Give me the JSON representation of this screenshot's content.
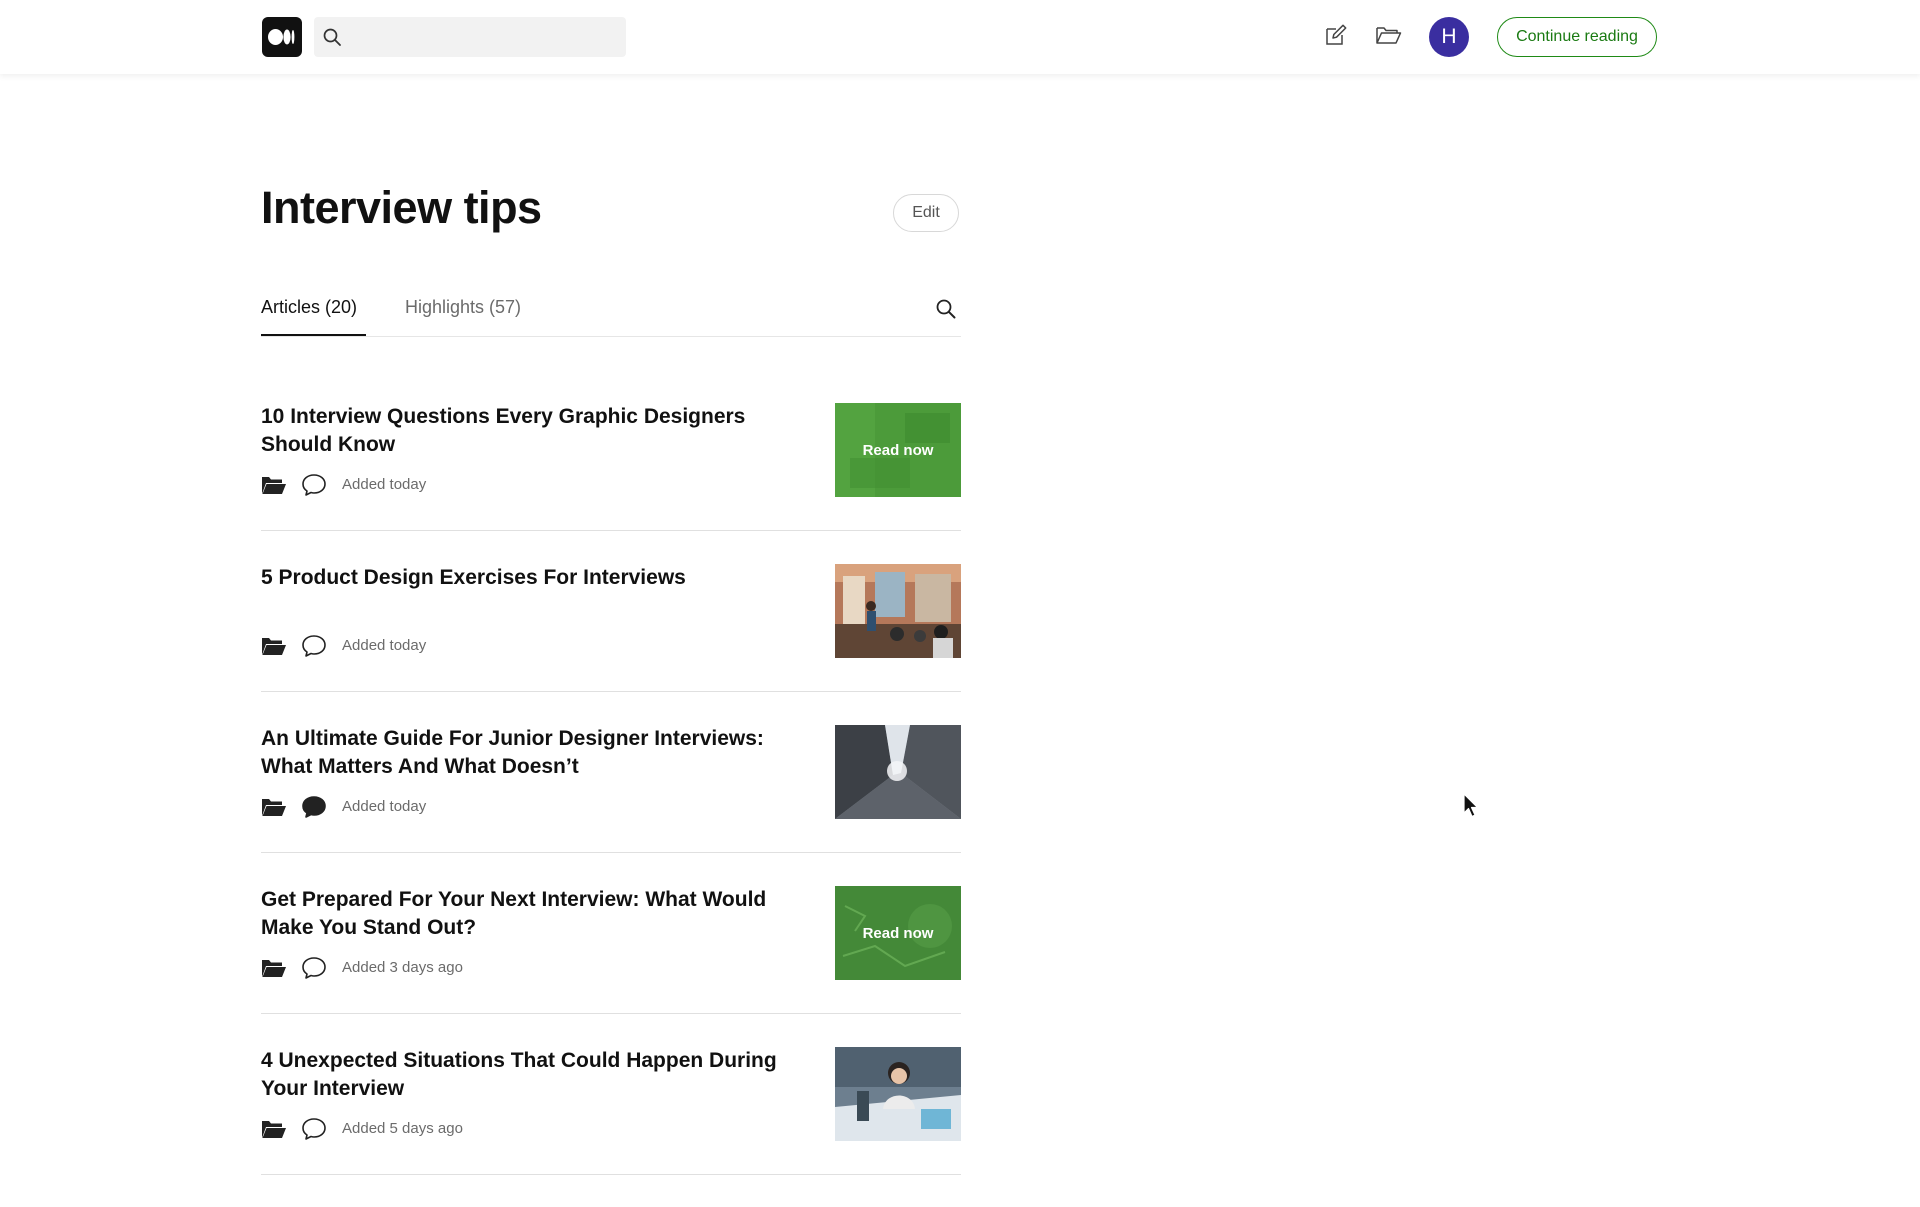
{
  "header": {
    "logo_name": "medium-logo",
    "search_placeholder": "",
    "avatar_initial": "H",
    "continue_label": "Continue reading"
  },
  "page": {
    "title": "Interview tips",
    "edit_label": "Edit"
  },
  "tabs": [
    {
      "label": "Articles (20)",
      "active": true
    },
    {
      "label": "Highlights (57)",
      "active": false
    }
  ],
  "articles": [
    {
      "title": "10 Interview Questions Every Graphic Designers Should Know",
      "added": "Added today",
      "overlay": "Read now",
      "comment_filled": false,
      "thumb": "green-read-now"
    },
    {
      "title": "5 Product Design Exercises For Interviews",
      "added": "Added today",
      "overlay": "",
      "comment_filled": false,
      "thumb": "office-meeting-photo"
    },
    {
      "title": "An Ultimate Guide For Junior Designer Interviews: What Matters And What Doesn’t",
      "added": "Added today",
      "overlay": "",
      "comment_filled": true,
      "thumb": "skyscrapers-photo"
    },
    {
      "title": "Get Prepared For Your Next Interview: What Would Make You Stand Out?",
      "added": "Added 3 days ago",
      "overlay": "Read now",
      "comment_filled": false,
      "thumb": "green-read-now"
    },
    {
      "title": "4 Unexpected Situations That Could Happen During Your Interview",
      "added": "Added 5 days ago",
      "overlay": "",
      "comment_filled": false,
      "thumb": "woman-at-desk-photo"
    }
  ],
  "colors": {
    "accent_green": "#1a7a12",
    "avatar_bg": "#3a2ea0",
    "read_now_green": "#4a9a3a"
  }
}
